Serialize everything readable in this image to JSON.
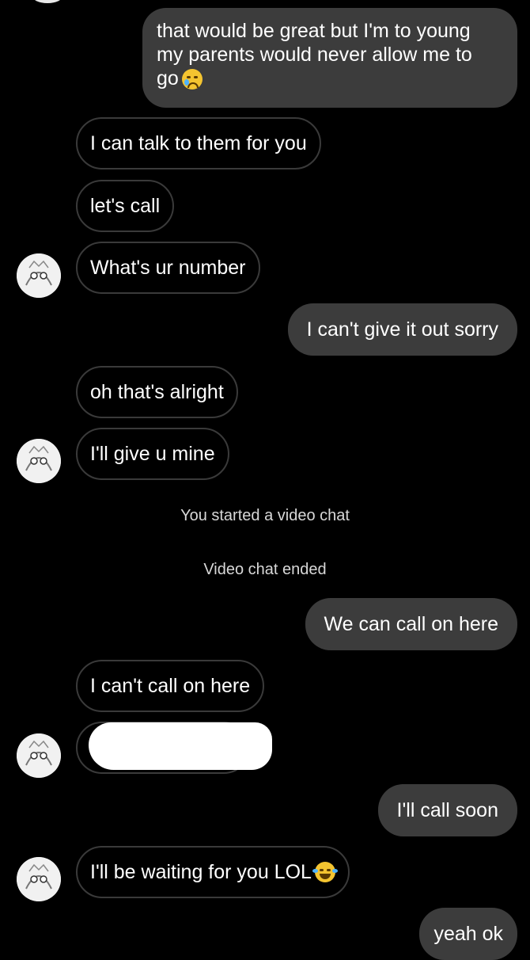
{
  "messages": [
    {
      "side": "out",
      "text": "that would be great but I'm to young my parents would never allow me to go",
      "emoji": "crying-face"
    },
    {
      "side": "in",
      "text": "I can talk to them for you"
    },
    {
      "side": "in",
      "text": "let's call"
    },
    {
      "side": "in",
      "text": "What's ur number"
    },
    {
      "side": "out",
      "text": "I can't give it out sorry"
    },
    {
      "side": "in",
      "text": "oh that's alright"
    },
    {
      "side": "in",
      "text": "I'll give u mine"
    },
    {
      "side": "system",
      "text": "You started a video chat"
    },
    {
      "side": "system",
      "text": "Video chat ended"
    },
    {
      "side": "out",
      "text": "We can call on here"
    },
    {
      "side": "in",
      "text": "I can't call on here"
    },
    {
      "side": "in",
      "text": "",
      "redacted": true
    },
    {
      "side": "out",
      "text": "I'll call soon"
    },
    {
      "side": "in",
      "text": "I'll be waiting for you LOL",
      "emoji": "face-with-tears-of-joy"
    },
    {
      "side": "out",
      "text": "yeah ok"
    }
  ]
}
